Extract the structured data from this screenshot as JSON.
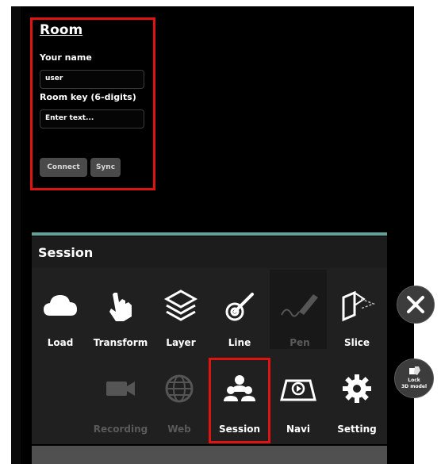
{
  "room": {
    "title": "Room",
    "name_label": "Your name",
    "name_value": "user",
    "key_label": "Room key (6-digits)",
    "key_placeholder": "Enter text...",
    "connect_label": "Connect",
    "sync_label": "Sync"
  },
  "session_panel": {
    "title": "Session"
  },
  "toolbar": {
    "row1": [
      {
        "label": "Load",
        "icon": "cloud-icon",
        "enabled": true
      },
      {
        "label": "Transform",
        "icon": "hand-icon",
        "enabled": true
      },
      {
        "label": "Layer",
        "icon": "layers-icon",
        "enabled": true
      },
      {
        "label": "Line",
        "icon": "line-icon",
        "enabled": true
      },
      {
        "label": "Pen",
        "icon": "pen-icon",
        "enabled": false
      },
      {
        "label": "Slice",
        "icon": "slice-icon",
        "enabled": true
      }
    ],
    "row2": [
      {
        "label": "Recording",
        "icon": "video-camera-icon",
        "enabled": false
      },
      {
        "label": "Web",
        "icon": "globe-icon",
        "enabled": false
      },
      {
        "label": "Session",
        "icon": "users-icon",
        "enabled": true
      },
      {
        "label": "Navi",
        "icon": "navigation-icon",
        "enabled": true
      },
      {
        "label": "Setting",
        "icon": "gear-icon",
        "enabled": true
      }
    ]
  },
  "floating": {
    "close_icon": "close-icon",
    "lock_line1": "Lock",
    "lock_line2": "3D model"
  },
  "colors": {
    "highlight": "#e01313",
    "divider": "#5fa39a"
  }
}
